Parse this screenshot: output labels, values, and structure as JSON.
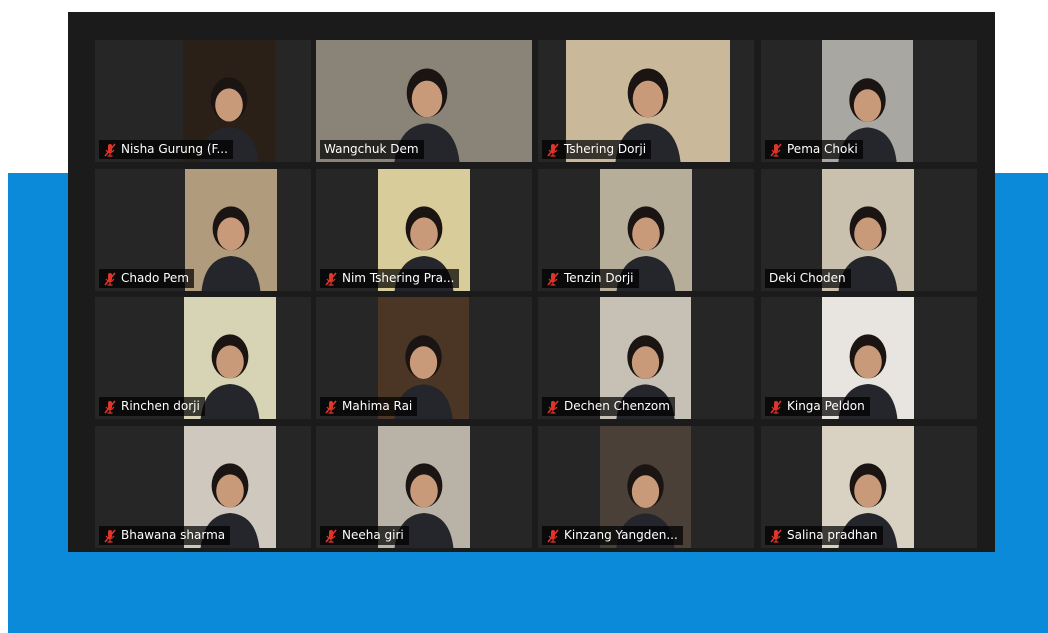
{
  "colors": {
    "band": "#0a8ad8",
    "window_bg": "#1b1b1b",
    "tile_bg": "#262626",
    "active_speaker": "#9ad63a",
    "muted_icon": "#e0352b"
  },
  "participants": [
    {
      "name": "Nisha Gurung (F...",
      "muted": true,
      "active": false,
      "video_color": "#2a2018"
    },
    {
      "name": "Wangchuk Dem",
      "muted": false,
      "active": true,
      "video_color": "#8a8478"
    },
    {
      "name": "Tshering Dorji",
      "muted": true,
      "active": false,
      "video_color": "#c9b89a"
    },
    {
      "name": "Pema Choki",
      "muted": true,
      "active": false,
      "video_color": "#a9a7a2"
    },
    {
      "name": "Chado Pem",
      "muted": true,
      "active": false,
      "video_color": "#b09b7c"
    },
    {
      "name": "Nim Tshering Pra...",
      "muted": true,
      "active": false,
      "video_color": "#d8cc9a"
    },
    {
      "name": "Tenzin Dorji",
      "muted": true,
      "active": false,
      "video_color": "#b7ae9a"
    },
    {
      "name": "Deki Choden",
      "muted": false,
      "active": false,
      "video_color": "#c9c0ae"
    },
    {
      "name": "Rinchen dorji",
      "muted": true,
      "active": false,
      "video_color": "#d6d4b4"
    },
    {
      "name": "Mahima Rai",
      "muted": true,
      "active": false,
      "video_color": "#4b3626"
    },
    {
      "name": "Dechen Chenzom",
      "muted": true,
      "active": false,
      "video_color": "#c7c1b5"
    },
    {
      "name": "Kinga Peldon",
      "muted": true,
      "active": false,
      "video_color": "#e8e4df"
    },
    {
      "name": "Bhawana sharma",
      "muted": true,
      "active": false,
      "video_color": "#cfc8bf"
    },
    {
      "name": "Neeha giri",
      "muted": true,
      "active": false,
      "video_color": "#b9b2a6"
    },
    {
      "name": "Kinzang Yangden...",
      "muted": true,
      "active": false,
      "video_color": "#4a4038"
    },
    {
      "name": "Salina pradhan",
      "muted": true,
      "active": false,
      "video_color": "#d9d2c2"
    }
  ]
}
